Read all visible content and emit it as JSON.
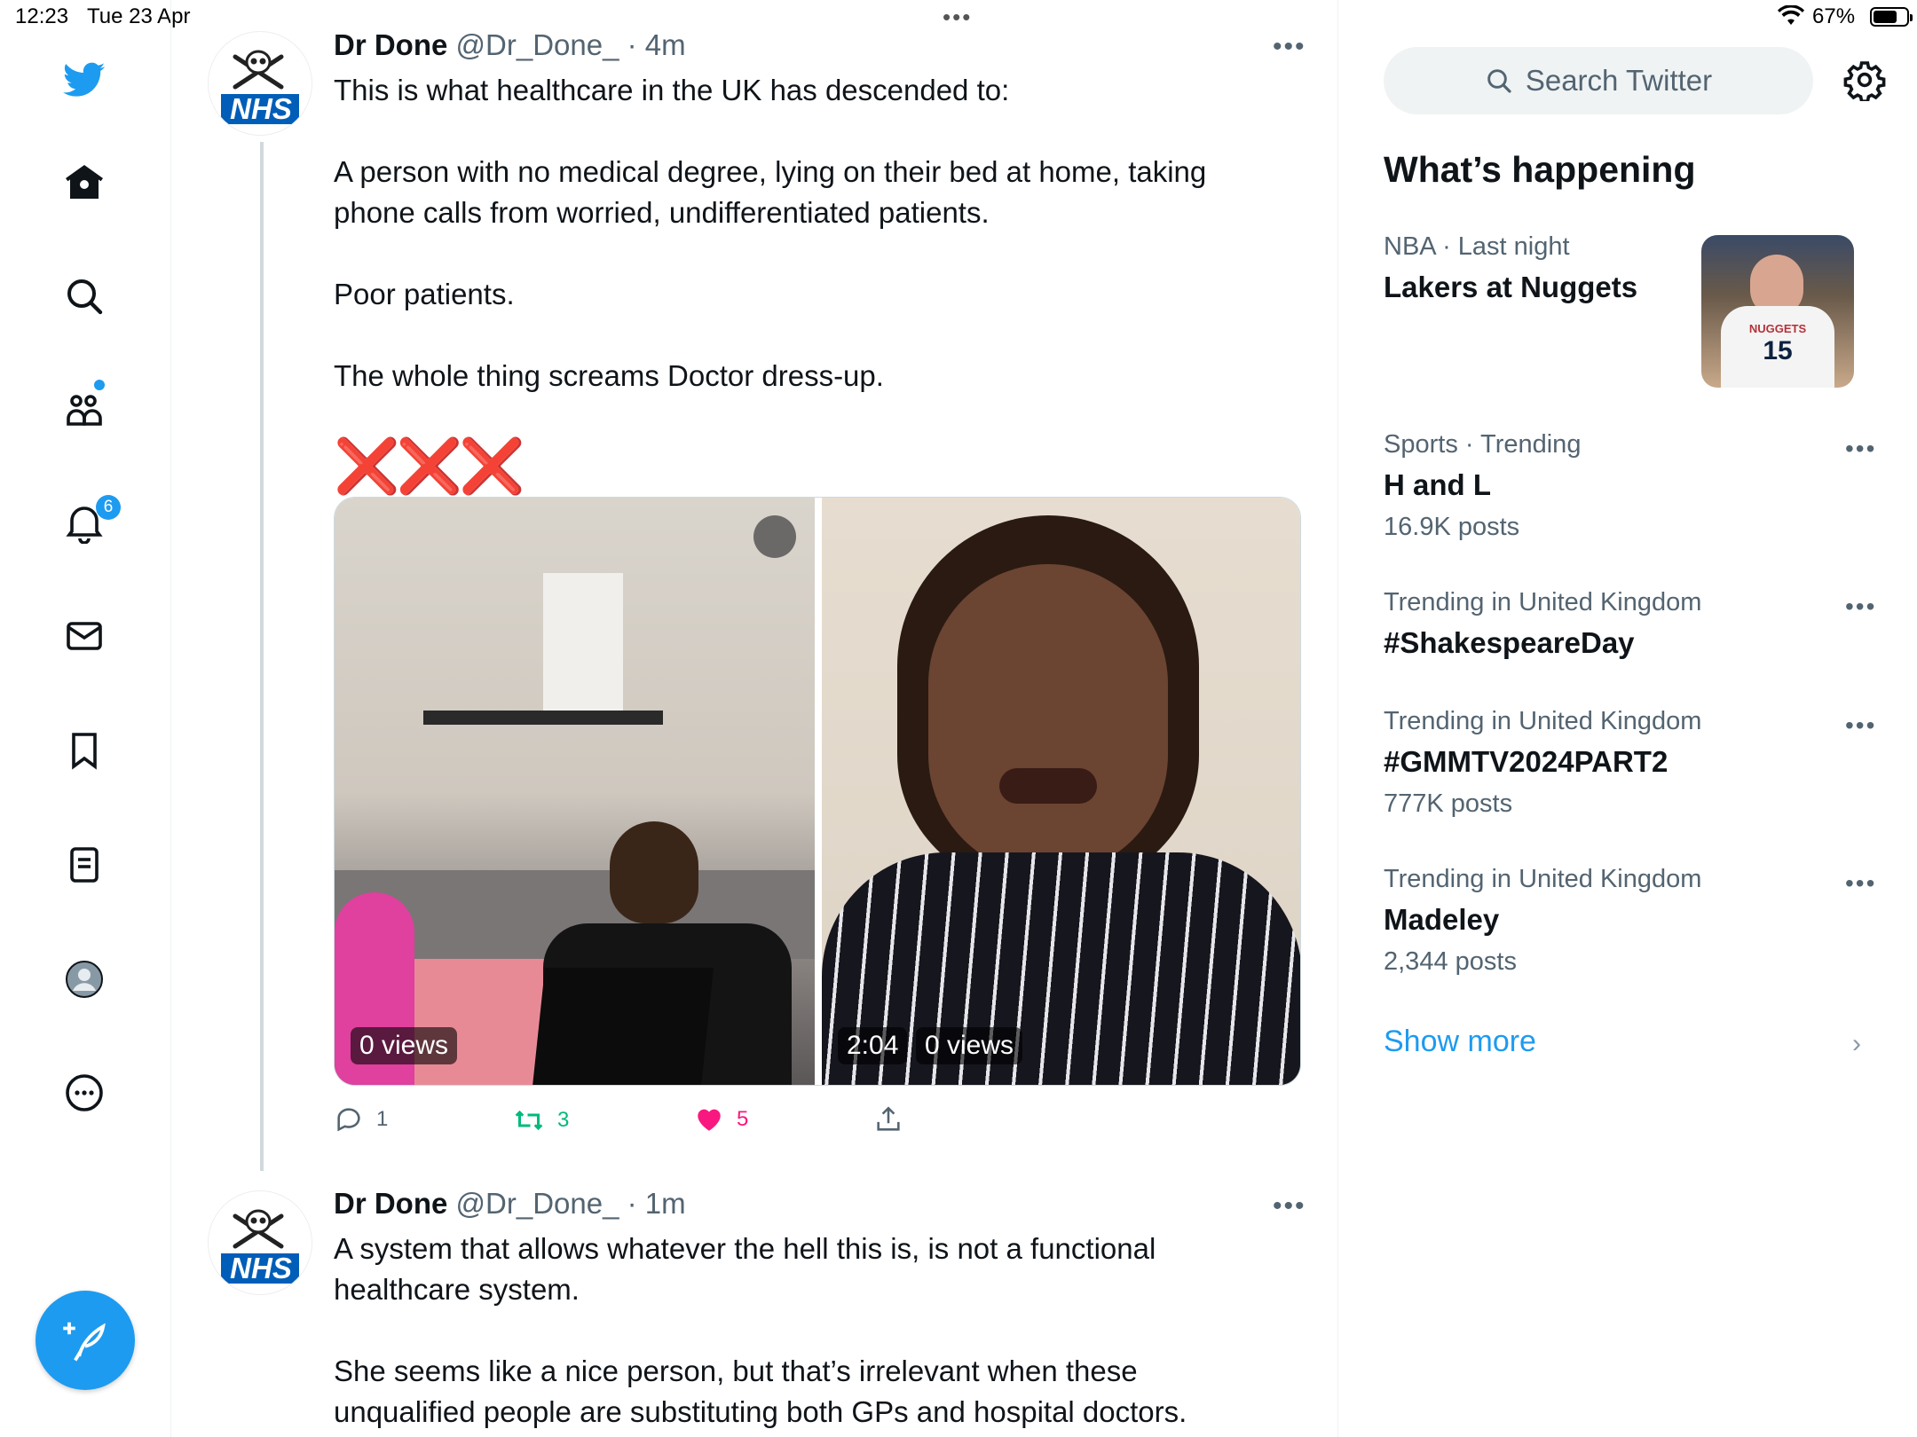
{
  "status_bar": {
    "time": "12:23",
    "date": "Tue 23 Apr",
    "battery": "67%"
  },
  "nav": {
    "notifications_badge": "6",
    "items": [
      "twitter-logo",
      "home",
      "explore",
      "communities",
      "notifications",
      "messages",
      "bookmarks",
      "lists",
      "profile",
      "more"
    ]
  },
  "tweets": [
    {
      "name": "Dr Done",
      "handle": "@Dr_Done_",
      "time": "· 4m",
      "avatar_text": "NHS",
      "text": "This is what healthcare in the UK has descended to:\n\nA person with no medical degree, lying on their bed at home, taking phone calls from worried, undifferentiated patients.\n\nPoor patients.\n\nThe whole thing screams Doctor dress-up.",
      "emoji": "❌❌❌",
      "media": [
        {
          "views": "0 views",
          "duration": ""
        },
        {
          "views": "0 views",
          "duration": "2:04"
        }
      ],
      "replies": "1",
      "retweets": "3",
      "likes": "5"
    },
    {
      "name": "Dr Done",
      "handle": "@Dr_Done_",
      "time": "· 1m",
      "avatar_text": "NHS",
      "text": "A system that allows whatever the hell this is, is not a functional healthcare system.\n\nShe seems like a nice person, but that’s irrelevant when these unqualified people are substituting both GPs and hospital doctors."
    }
  ],
  "sidebar": {
    "search_placeholder": "Search Twitter",
    "heading": "What’s happening",
    "trends": [
      {
        "context": "NBA · Last night",
        "topic": "Lakers at Nuggets",
        "count": "",
        "thumb_number": "15",
        "thumb_team": "NUGGETS"
      },
      {
        "context": "Sports · Trending",
        "topic": "H and L",
        "count": "16.9K posts"
      },
      {
        "context": "Trending in United Kingdom",
        "topic": "#ShakespeareDay",
        "count": ""
      },
      {
        "context": "Trending in United Kingdom",
        "topic": "#GMMTV2024PART2",
        "count": "777K posts"
      },
      {
        "context": "Trending in United Kingdom",
        "topic": "Madeley",
        "count": "2,344 posts"
      }
    ],
    "show_more": "Show more"
  },
  "colors": {
    "accent": "#1d9bf0",
    "retweet": "#00ba7c",
    "like": "#f91880",
    "nhs_blue": "#005eb8"
  }
}
